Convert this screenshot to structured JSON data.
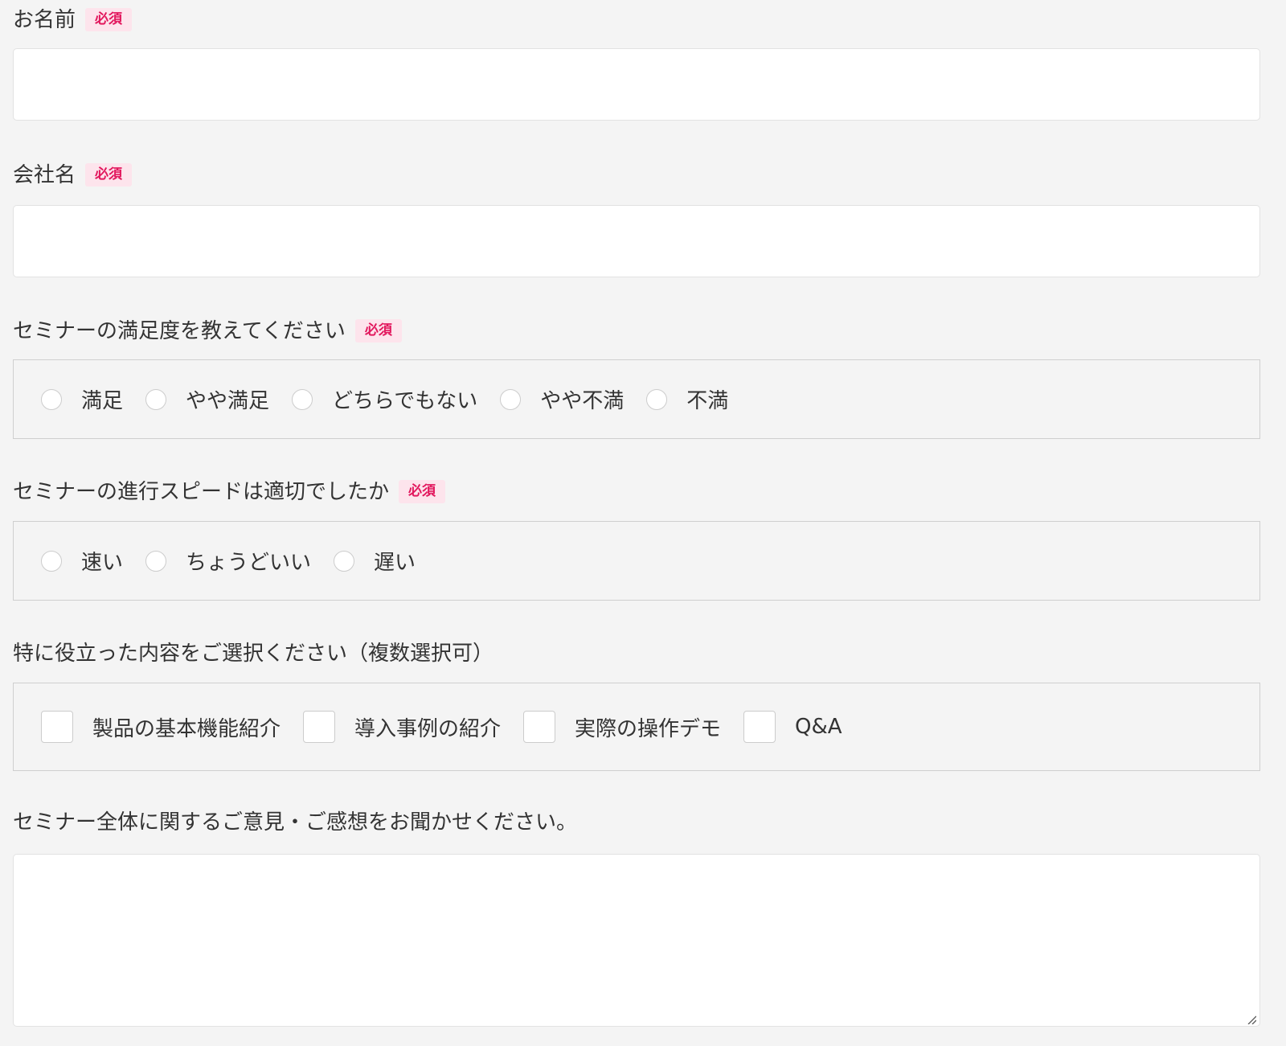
{
  "required_badge": "必須",
  "fields": {
    "name": {
      "label": "お名前",
      "value": "",
      "placeholder": ""
    },
    "company": {
      "label": "会社名",
      "value": "",
      "placeholder": ""
    }
  },
  "satisfaction": {
    "label": "セミナーの満足度を教えてください",
    "options": [
      "満足",
      "やや満足",
      "どちらでもない",
      "やや不満",
      "不満"
    ]
  },
  "speed": {
    "label": "セミナーの進行スピードは適切でしたか",
    "options": [
      "速い",
      "ちょうどいい",
      "遅い"
    ]
  },
  "useful": {
    "label": "特に役立った内容をご選択ください（複数選択可）",
    "options": [
      "製品の基本機能紹介",
      "導入事例の紹介",
      "実際の操作デモ",
      "Q&A"
    ]
  },
  "feedback": {
    "label": "セミナー全体に関するご意見・ご感想をお聞かせください。",
    "value": "",
    "placeholder": ""
  },
  "colors": {
    "background": "#f4f4f4",
    "badge_background": "#fde4ec",
    "badge_text": "#e2175d",
    "text": "#333333",
    "border": "#cfcfcf"
  }
}
